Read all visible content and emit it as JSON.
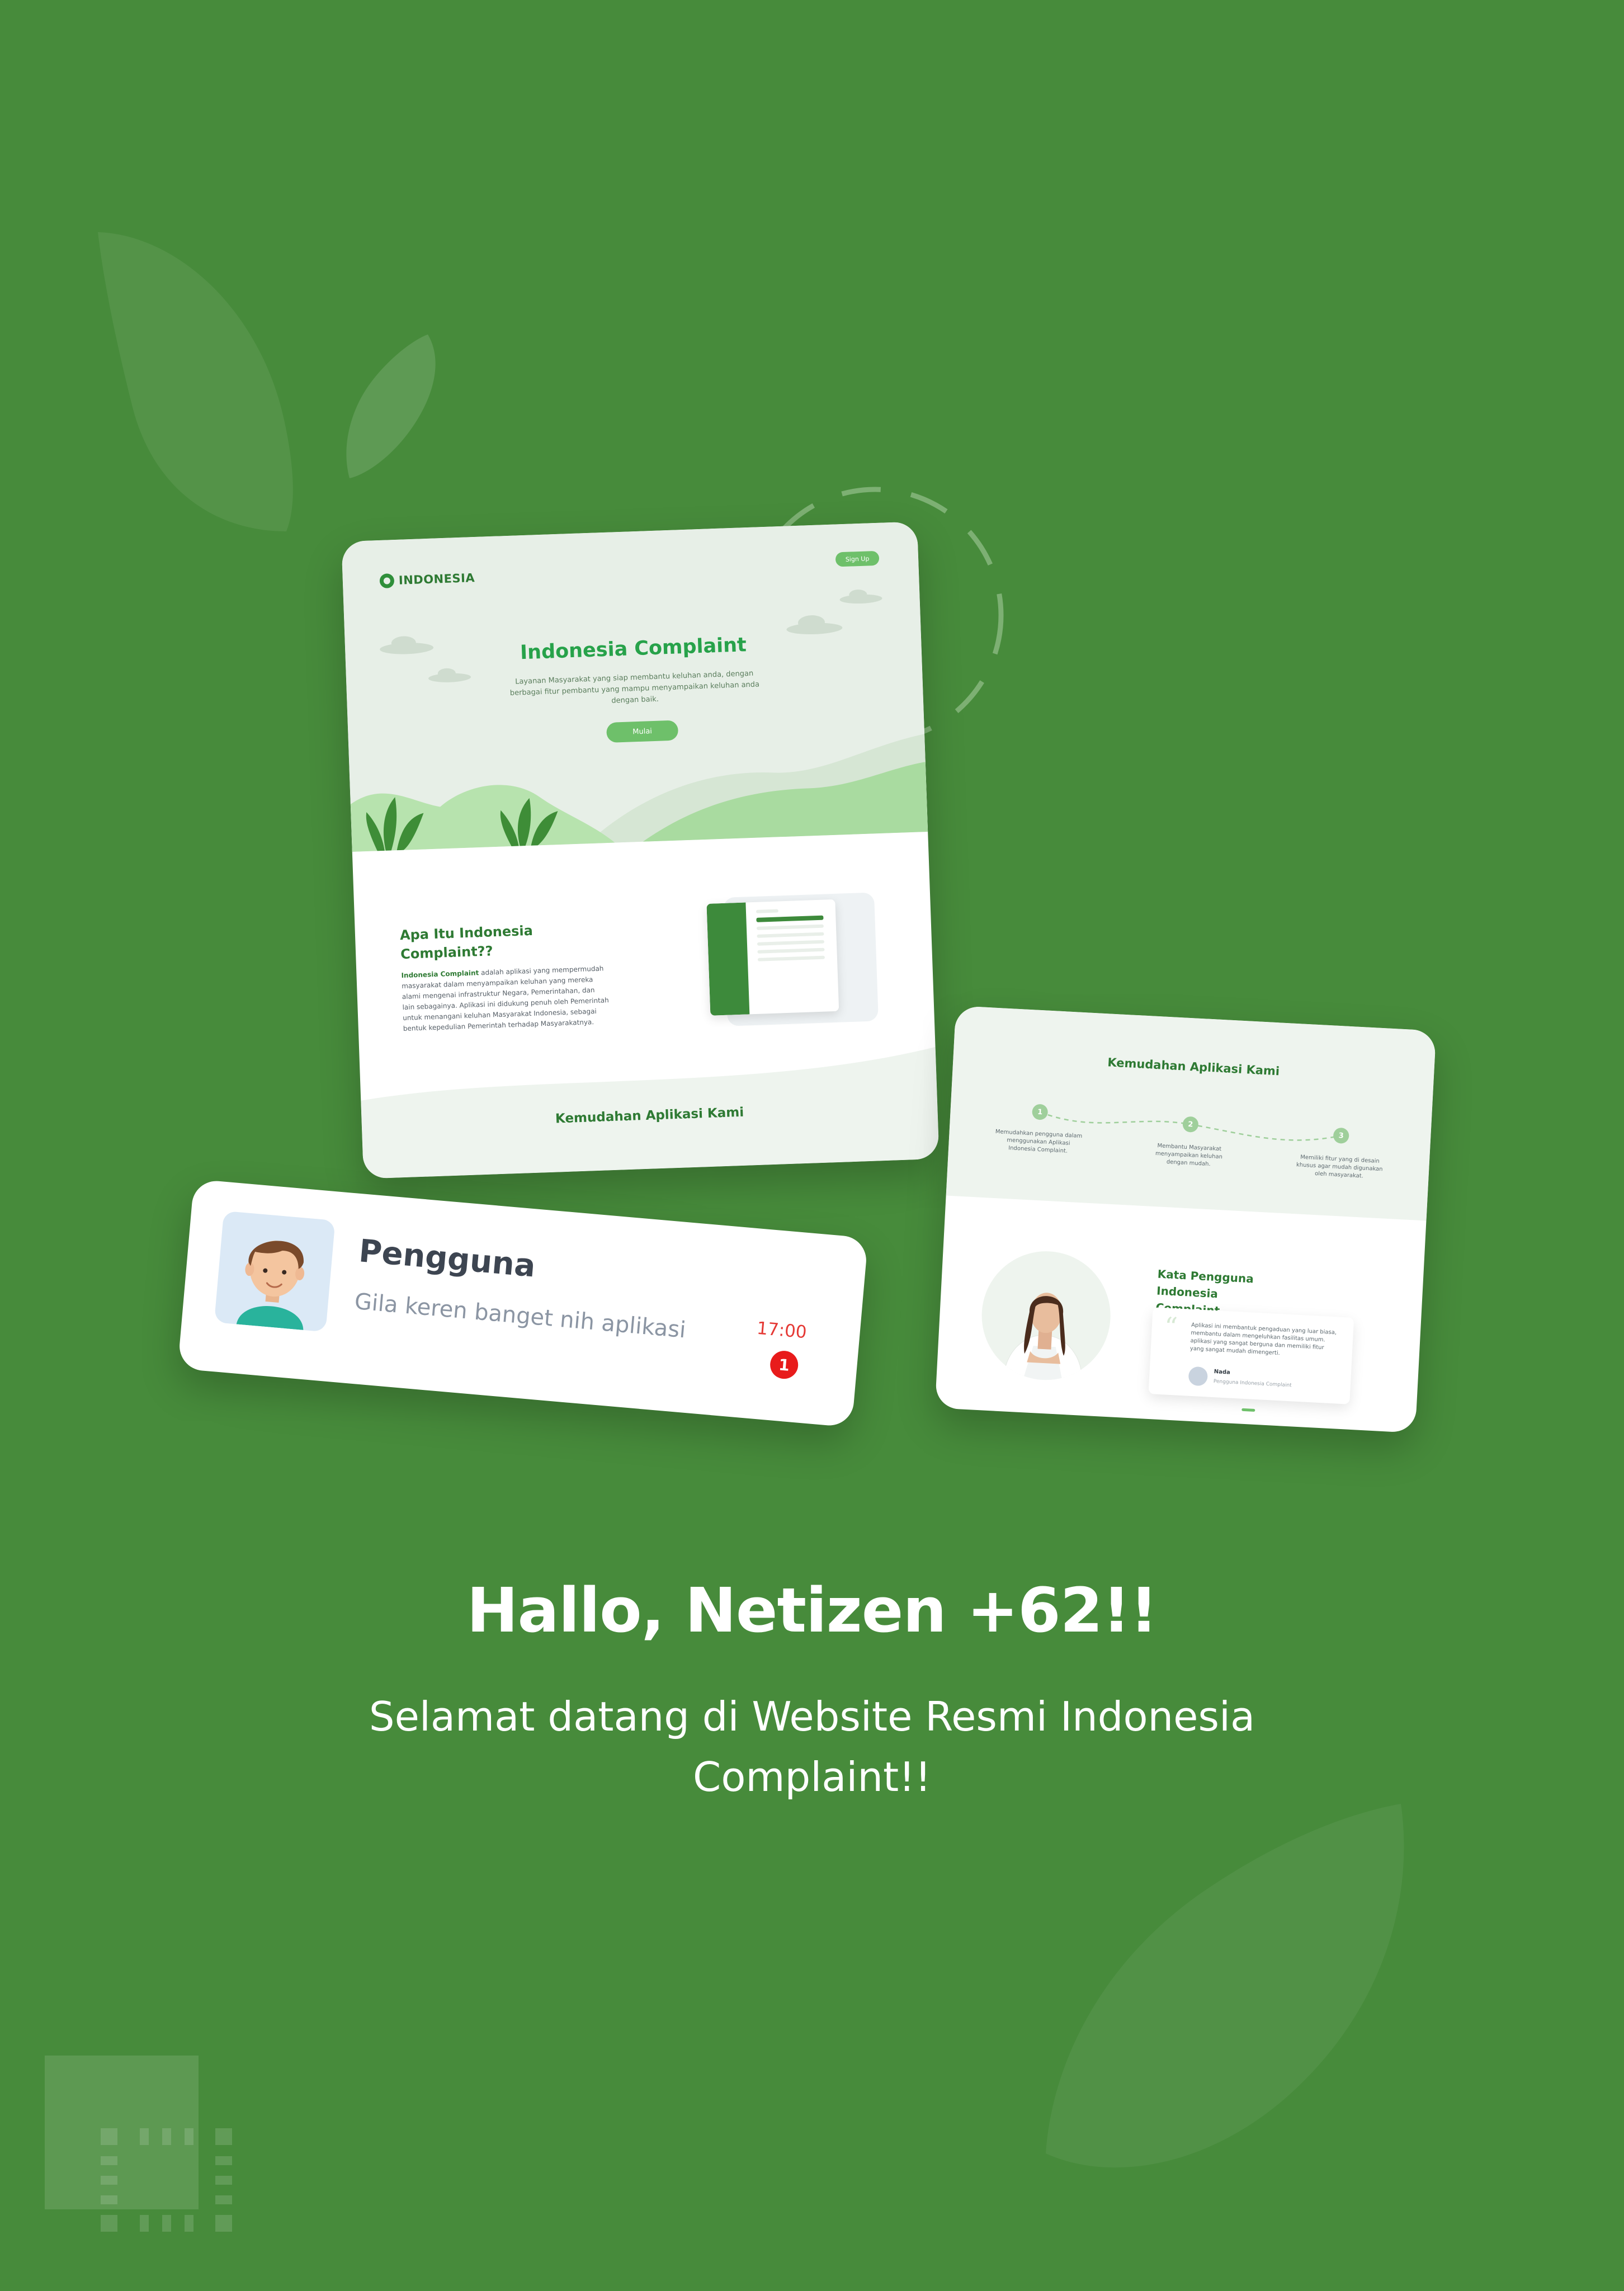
{
  "colors": {
    "background": "#478b3b",
    "accent_green": "#27a24a",
    "dark_green": "#2e7a33",
    "button_green": "#6ec06a",
    "notification_red": "#e81b1b"
  },
  "landing_card": {
    "logo_text": "INDONESIA",
    "signup_label": "Sign Up",
    "hero_title": "Indonesia Complaint",
    "hero_description": "Layanan Masyarakat yang siap membantu keluhan anda, dengan berbagai fitur pembantu yang mampu menyampaikan keluhan anda dengan baik.",
    "start_button": "Mulai",
    "about_title": "Apa Itu Indonesia Complaint??",
    "about_highlight": "Indonesia Complaint",
    "about_body": " adalah aplikasi yang mempermudah masyarakat dalam menyampaikan keluhan yang mereka alami mengenai infrastruktur Negara, Pemerintahan, dan lain sebagainya. Aplikasi ini didukung penuh oleh Pemerintah untuk menangani keluhan Masyarakat Indonesia, sebagai bentuk kepedulian Pemerintah terhadap Masyarakatnya.",
    "features_title": "Kemudahan Aplikasi Kami"
  },
  "features_card": {
    "title": "Kemudahan Aplikasi Kami",
    "steps": [
      {
        "num": "1",
        "text": "Memudahkan pengguna dalam menggunakan Aplikasi Indonesia Complaint."
      },
      {
        "num": "2",
        "text": "Membantu Masyarakat menyampaikan keluhan dengan mudah."
      },
      {
        "num": "3",
        "text": "Memiliki fitur yang di desain khusus agar mudah digunakan oleh masyarakat."
      }
    ],
    "testimonial_title": "Kata Pengguna Indonesia Complaint",
    "testimonial_quote": "Aplikasi ini membantuk pengaduan yang luar biasa, membantu dalam mengeluhkan fasilitas umum. aplikasi yang sangat berguna dan memiliki fitur yang sangat mudah dimengerti.",
    "testimonial_name": "Nada",
    "testimonial_role": "Pengguna Indonesia Complaint"
  },
  "notification": {
    "name": "Pengguna",
    "message": "Gila keren banget nih aplikasi",
    "time": "17:00",
    "badge": "1"
  },
  "headline": "Hallo, Netizen +62!!",
  "subheadline": "Selamat datang di Website Resmi Indonesia Complaint!!",
  "icons": {
    "logo": "location-pin-icon",
    "quote": "quote-icon",
    "avatar": "user-avatar-icon"
  }
}
